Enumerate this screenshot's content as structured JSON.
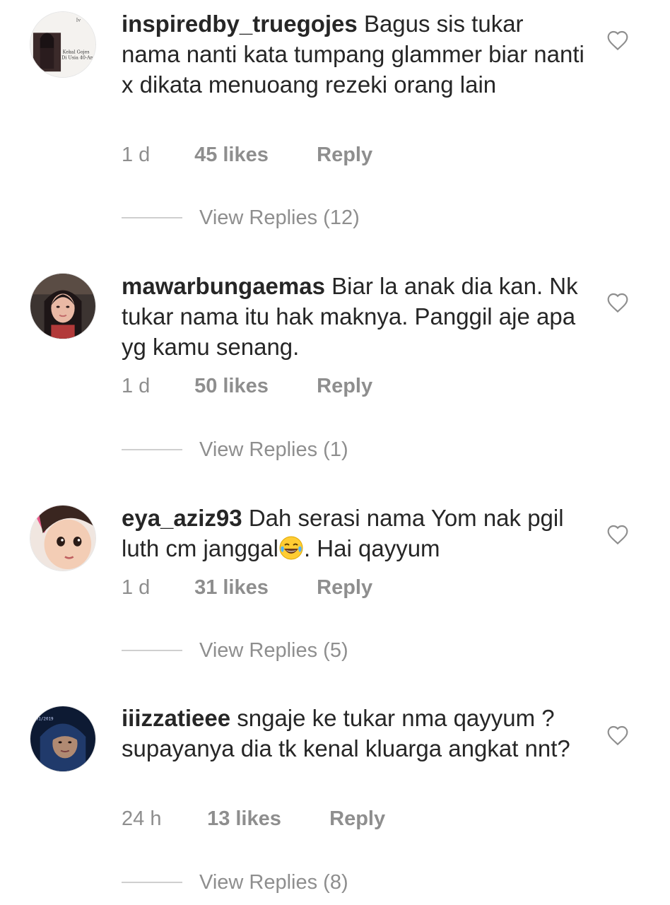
{
  "comments": [
    {
      "username": "inspiredby_truegojes",
      "text": "Bagus sis tukar nama nanti kata tumpang glammer biar nanti x dikata menuoang rezeki orang lain",
      "time": "1 d",
      "likes": "45 likes",
      "reply_label": "Reply",
      "view_replies": "View Replies (12)",
      "avatar_text_line1": "Kekal Gojes",
      "avatar_text_line2": "Di Usia 40-An",
      "avatar_tag": "Iv"
    },
    {
      "username": "mawarbungaemas",
      "text": "Biar la anak dia kan. Nk tukar nama itu hak maknya. Panggil aje apa yg kamu senang.",
      "time": "1 d",
      "likes": "50 likes",
      "reply_label": "Reply",
      "view_replies": "View Replies (1)"
    },
    {
      "username": "eya_aziz93",
      "text_before_emoji": "Dah serasi nama Yom nak pgil luth cm janggal",
      "text_after_emoji": ". Hai qayyum",
      "time": "1 d",
      "likes": "31 likes",
      "reply_label": "Reply",
      "view_replies": "View Replies (5)"
    },
    {
      "username": "iiizzatieee",
      "text": "sngaje ke tukar nma qayyum ? supayanya dia tk kenal kluarga angkat nnt?",
      "time": "24 h",
      "likes": "13 likes",
      "reply_label": "Reply",
      "view_replies": "View Replies (8)",
      "avatar_stamp": "01/2019"
    }
  ],
  "icons": {
    "like": "heart-outline-icon",
    "emoji": "face-with-tears-of-joy"
  },
  "colors": {
    "text": "#262626",
    "meta": "#8e8e8e",
    "divider": "#cfcfcf"
  }
}
